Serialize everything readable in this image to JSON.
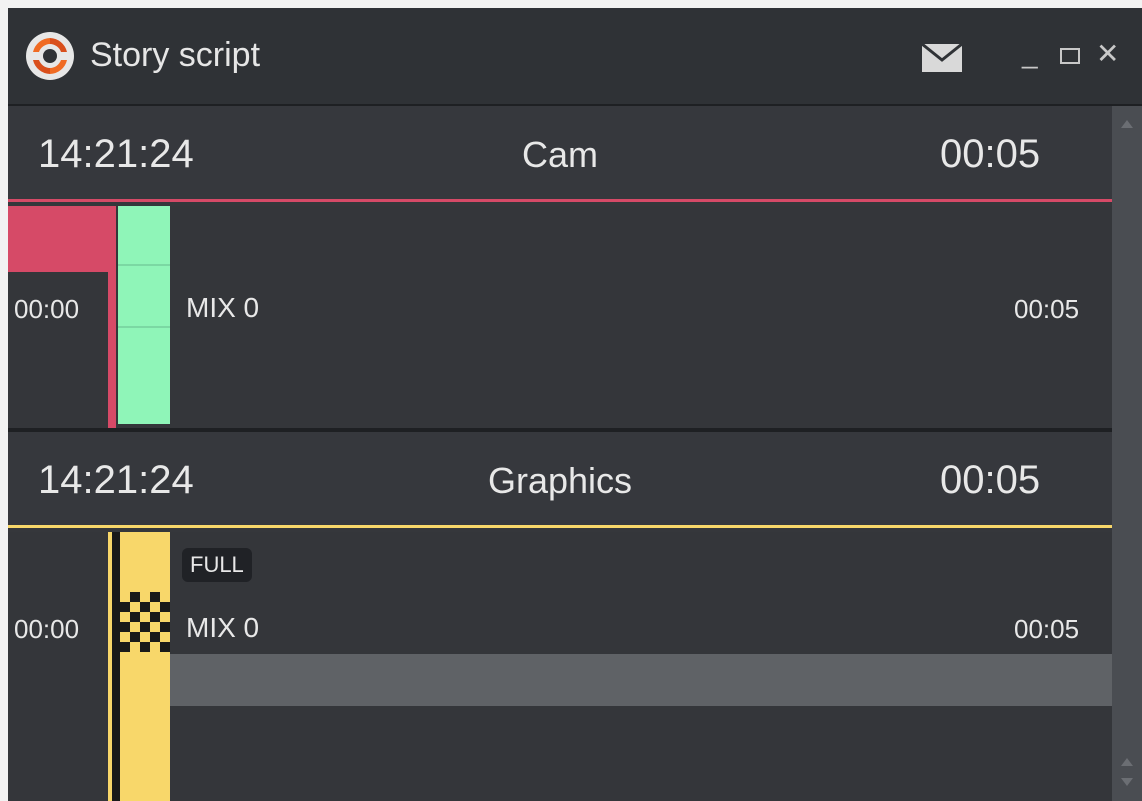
{
  "window": {
    "title": "Story script"
  },
  "icons": {
    "app_logo": "refresh-logo-icon",
    "mail": "mail-icon",
    "minimize": "minimize-icon",
    "maximize": "maximize-icon",
    "close": "close-icon"
  },
  "colors": {
    "cam_accent": "#d64a67",
    "cam_green": "#8ff5b8",
    "graphics_accent": "#f8d76a"
  },
  "sections": [
    {
      "time": "14:21:24",
      "label": "Cam",
      "duration": "00:05",
      "row": {
        "start": "00:00",
        "mix": "MIX 0",
        "end": "00:05"
      }
    },
    {
      "time": "14:21:24",
      "label": "Graphics",
      "duration": "00:05",
      "row": {
        "badge": "FULL",
        "start": "00:00",
        "mix": "MIX 0",
        "end": "00:05"
      }
    }
  ]
}
